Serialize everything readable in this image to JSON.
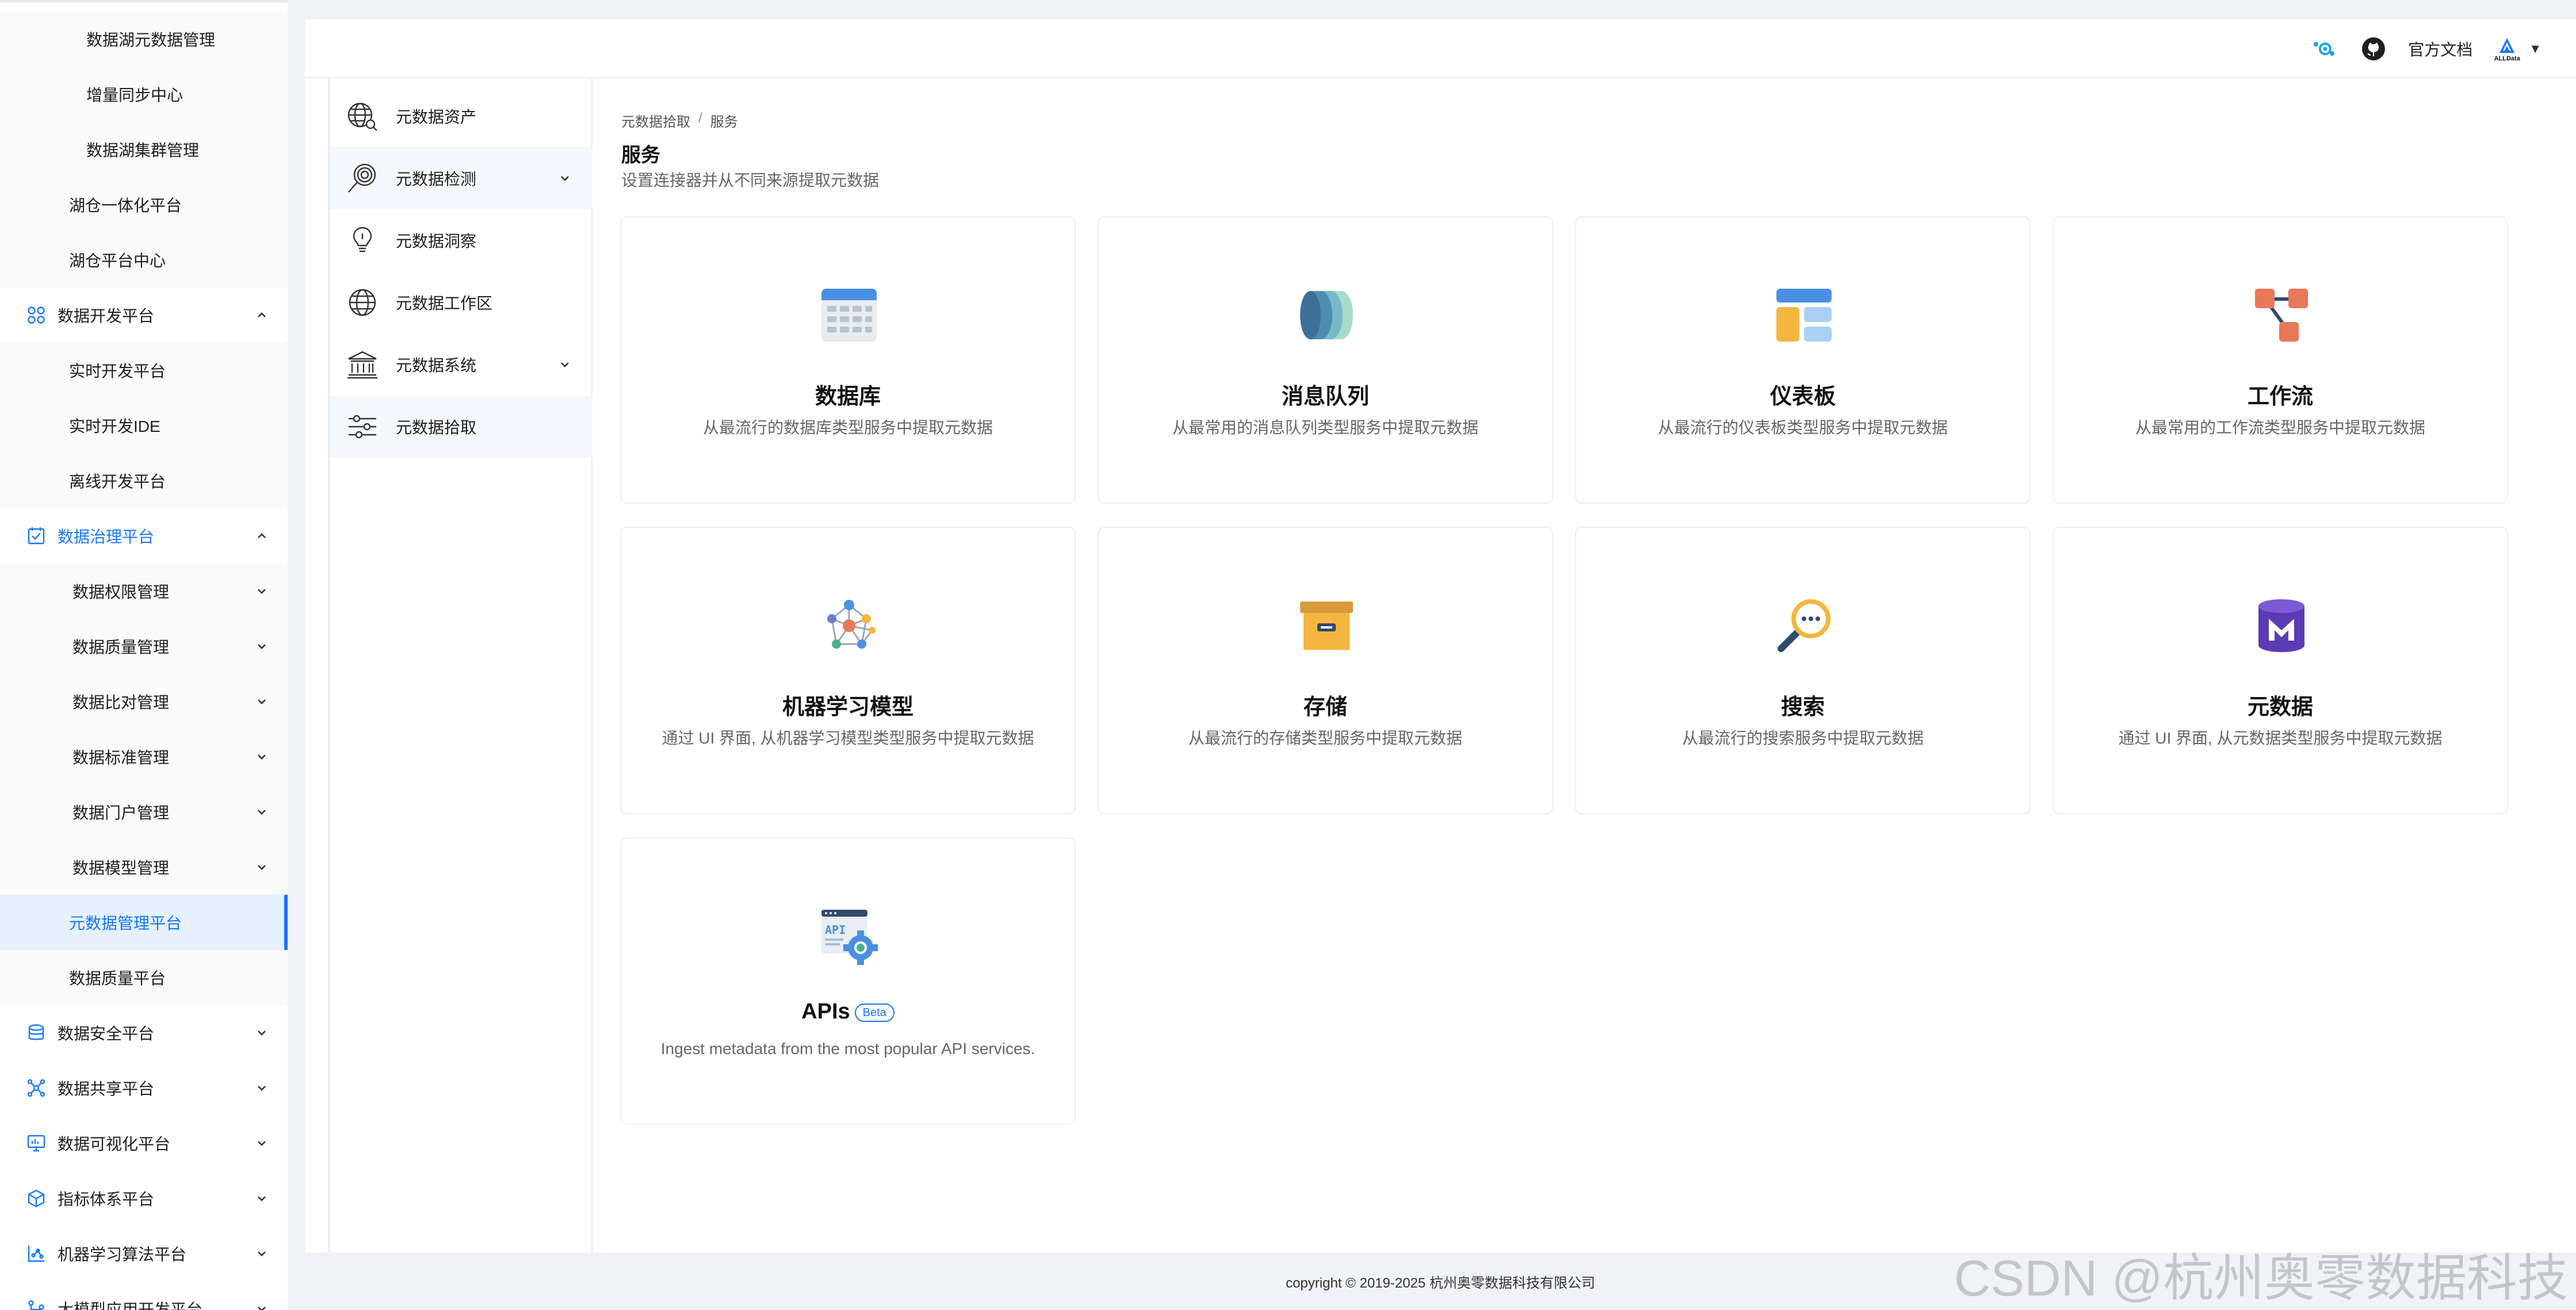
{
  "sidebar": {
    "items": [
      {
        "label": "数据湖元数据管理",
        "kind": "sub3"
      },
      {
        "label": "增量同步中心",
        "kind": "sub3"
      },
      {
        "label": "数据湖集群管理",
        "kind": "sub3"
      },
      {
        "label": "湖仓一体化平台",
        "kind": "sub2"
      },
      {
        "label": "湖仓平台中心",
        "kind": "sub2"
      },
      {
        "label": "数据开发平台",
        "kind": "group",
        "icon": "cluster-icon",
        "chevron": "up"
      },
      {
        "label": "实时开发平台",
        "kind": "sub2"
      },
      {
        "label": "实时开发IDE",
        "kind": "sub2"
      },
      {
        "label": "离线开发平台",
        "kind": "sub2"
      },
      {
        "label": "数据治理平台",
        "kind": "group-active",
        "icon": "checklist-icon",
        "chevron": "up"
      },
      {
        "label": "数据权限管理",
        "kind": "sub2c",
        "chevron": "down"
      },
      {
        "label": "数据质量管理",
        "kind": "sub2c",
        "chevron": "down"
      },
      {
        "label": "数据比对管理",
        "kind": "sub2c",
        "chevron": "down"
      },
      {
        "label": "数据标准管理",
        "kind": "sub2c",
        "chevron": "down"
      },
      {
        "label": "数据门户管理",
        "kind": "sub2c",
        "chevron": "down"
      },
      {
        "label": "数据模型管理",
        "kind": "sub2c",
        "chevron": "down"
      },
      {
        "label": "元数据管理平台",
        "kind": "selected"
      },
      {
        "label": "数据质量平台",
        "kind": "sub2"
      },
      {
        "label": "数据安全平台",
        "kind": "group",
        "icon": "database-icon",
        "chevron": "down"
      },
      {
        "label": "数据共享平台",
        "kind": "group",
        "icon": "network-icon",
        "chevron": "down"
      },
      {
        "label": "数据可视化平台",
        "kind": "group",
        "icon": "monitor-icon",
        "chevron": "down"
      },
      {
        "label": "指标体系平台",
        "kind": "group",
        "icon": "cube-icon",
        "chevron": "down"
      },
      {
        "label": "机器学习算法平台",
        "kind": "group",
        "icon": "scatter-icon",
        "chevron": "down"
      },
      {
        "label": "大模型应用开发平台",
        "kind": "group",
        "icon": "branch-icon",
        "chevron": "down"
      }
    ]
  },
  "topbar": {
    "docs_label": "官方文档",
    "logo_text": "ALLData",
    "caret": "▼"
  },
  "subnav": {
    "items": [
      {
        "label": "元数据资产",
        "icon": "globe-search-icon"
      },
      {
        "label": "元数据检测",
        "icon": "magnifier-icon",
        "chevron": true,
        "highlight": true
      },
      {
        "label": "元数据洞察",
        "icon": "lightbulb-icon"
      },
      {
        "label": "元数据工作区",
        "icon": "globe-icon"
      },
      {
        "label": "元数据系统",
        "icon": "bank-icon",
        "chevron": true
      },
      {
        "label": "元数据拾取",
        "icon": "sliders-icon",
        "highlight": true
      }
    ]
  },
  "breadcrumb": {
    "first": "元数据拾取",
    "separator": "/",
    "current": "服务"
  },
  "page": {
    "title": "服务",
    "subtitle": "设置连接器并从不同来源提取元数据"
  },
  "cards": [
    {
      "title": "数据库",
      "desc": "从最流行的数据库类型服务中提取元数据",
      "icon": "database-table-icon"
    },
    {
      "title": "消息队列",
      "desc": "从最常用的消息队列类型服务中提取元数据",
      "icon": "message-queue-icon"
    },
    {
      "title": "仪表板",
      "desc": "从最流行的仪表板类型服务中提取元数据",
      "icon": "dashboard-icon"
    },
    {
      "title": "工作流",
      "desc": "从最常用的工作流类型服务中提取元数据",
      "icon": "workflow-icon"
    },
    {
      "title": "机器学习模型",
      "desc": "通过 UI 界面, 从机器学习模型类型服务中提取元数据",
      "icon": "ml-model-icon"
    },
    {
      "title": "存储",
      "desc": "从最流行的存储类型服务中提取元数据",
      "icon": "storage-box-icon"
    },
    {
      "title": "搜索",
      "desc": "从最流行的搜索服务中提取元数据",
      "icon": "search-service-icon"
    },
    {
      "title": "元数据",
      "desc": "通过 UI 界面, 从元数据类型服务中提取元数据",
      "icon": "metadata-m-icon"
    },
    {
      "title": "APIs",
      "badge": "Beta",
      "desc": "Ingest metadata from the most popular API services.",
      "icon": "api-gear-icon"
    }
  ],
  "footer": {
    "copyright": "copyright © 2019-2025 杭州奥零数据科技有限公司"
  },
  "watermark": "CSDN @杭州奥零数据科技",
  "colors": {
    "accent": "#1677ff",
    "selected_bg": "#e6f0ff",
    "background": "#f0f2f5"
  }
}
